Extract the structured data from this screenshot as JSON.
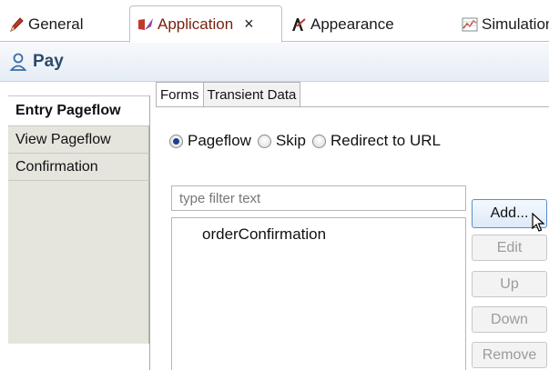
{
  "tabs": [
    {
      "label": "General",
      "icon": "pencil-icon"
    },
    {
      "label": "Application",
      "icon": "application-icon",
      "close": "×"
    },
    {
      "label": "Appearance",
      "icon": "appearance-icon"
    },
    {
      "label": "Simulation",
      "icon": "simulation-icon"
    }
  ],
  "header": {
    "title": "Pay",
    "icon": "person-icon"
  },
  "left_nav": {
    "items": [
      {
        "label": "Entry Pageflow",
        "active": true
      },
      {
        "label": "View Pageflow",
        "active": false
      },
      {
        "label": "Confirmation",
        "active": false
      }
    ]
  },
  "inner_tabs": [
    {
      "label": "Forms",
      "active": true
    },
    {
      "label": "Transient Data",
      "active": false
    }
  ],
  "radio_options": [
    {
      "label": "Pageflow",
      "checked": true
    },
    {
      "label": "Skip",
      "checked": false
    },
    {
      "label": "Redirect to URL",
      "checked": false
    }
  ],
  "filter": {
    "placeholder": "type filter text"
  },
  "list": {
    "items": [
      "orderConfirmation"
    ]
  },
  "buttons": {
    "add": "Add...",
    "edit": "Edit",
    "up": "Up",
    "down": "Down",
    "remove": "Remove"
  },
  "colors": {
    "header_title": "#2c4a6d",
    "radio_selected": "#1c3f8e",
    "nav_background": "#e5e5de",
    "add_button_border": "#5b8ed0"
  }
}
